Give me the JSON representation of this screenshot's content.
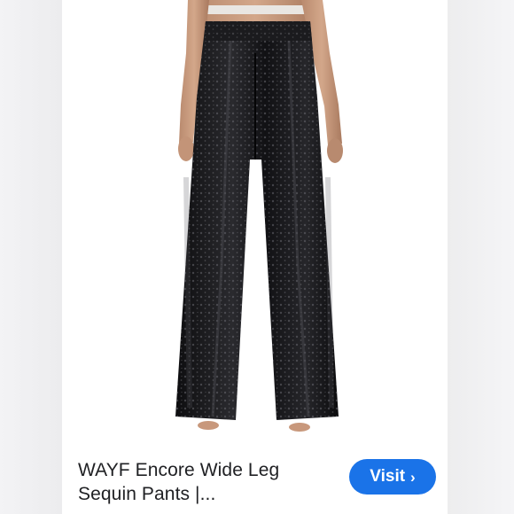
{
  "result_card": {
    "title_line1": "WAYF Encore Wide Leg",
    "title_line2": "Sequin Pants |...",
    "image_subject": "black-sequin-wide-leg-pants",
    "visit_label": "Visit",
    "visit_icon": "chevron-right-icon",
    "chevron_glyph": "›"
  },
  "colors": {
    "accent": "#1a73e8",
    "title_text": "#202124",
    "background": "#ffffff"
  }
}
